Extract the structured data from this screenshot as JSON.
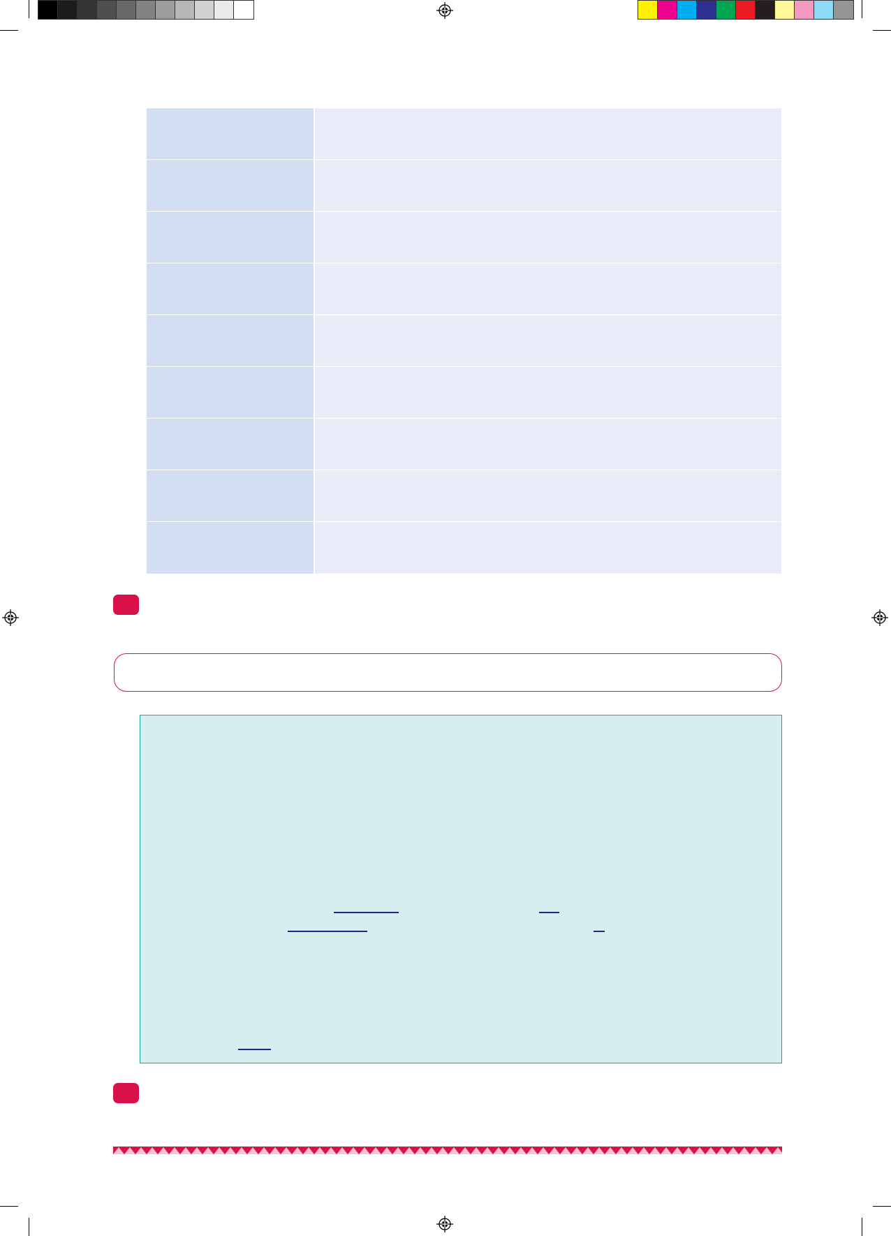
{
  "print_marks": {
    "gray_swatches": [
      "#000000",
      "#1c1c1c",
      "#353535",
      "#4f4f4f",
      "#696969",
      "#838383",
      "#9d9d9d",
      "#b7b7b7",
      "#d1d1d1",
      "#ebebeb",
      "#ffffff"
    ],
    "color_swatches": [
      "#fff200",
      "#ec008c",
      "#00aeef",
      "#2e3192",
      "#00a651",
      "#ed1c24",
      "#231f20",
      "#fff799",
      "#f49ac1",
      "#8ed8f8",
      "#959595"
    ],
    "registration_icon": "crosshair-target-icon"
  },
  "table": {
    "rows": [
      {
        "label": "",
        "value": ""
      },
      {
        "label": "",
        "value": ""
      },
      {
        "label": "",
        "value": ""
      },
      {
        "label": "",
        "value": ""
      },
      {
        "label": "",
        "value": ""
      },
      {
        "label": "",
        "value": ""
      },
      {
        "label": "",
        "value": ""
      },
      {
        "label": "",
        "value": ""
      },
      {
        "label": "",
        "value": ""
      }
    ],
    "label_color": "#d2def2",
    "value_color": "#e8ecf8"
  },
  "accent_color": "#d8114a",
  "infobox_color": "#d6eef0",
  "infobox_border": "#1aa3a8",
  "link_underline_color": "#1b2a88"
}
